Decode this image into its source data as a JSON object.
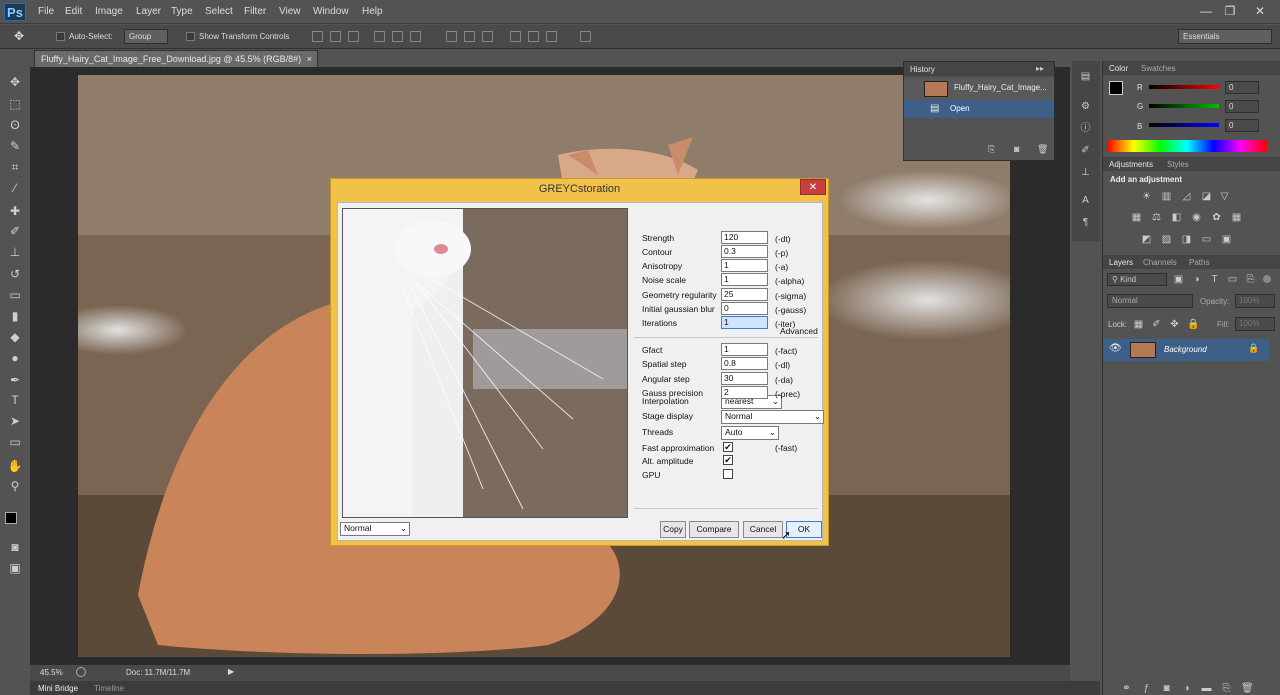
{
  "app": {
    "logo": "Ps"
  },
  "menu": [
    "File",
    "Edit",
    "Image",
    "Layer",
    "Type",
    "Select",
    "Filter",
    "View",
    "Window",
    "Help"
  ],
  "window_controls": {
    "minimize": "—",
    "restore": "❐",
    "close": "✕"
  },
  "options_bar": {
    "auto_select_label": "Auto-Select:",
    "auto_select_value": "Group",
    "transform_label": "Show Transform Controls",
    "workspace": "Essentials"
  },
  "document": {
    "tab_title": "Fluffy_Hairy_Cat_Image_Free_Download.jpg @ 45.5% (RGB/8#)",
    "zoom": "45.5%",
    "doc_size": "Doc: 11.7M/11.7M"
  },
  "bottom_tabs": [
    "Mini Bridge",
    "Timeline"
  ],
  "history": {
    "tab": "History",
    "items": [
      {
        "label": "Fluffy_Hairy_Cat_Image..."
      },
      {
        "label": "Open"
      }
    ]
  },
  "color_panel": {
    "tabs": [
      "Color",
      "Swatches"
    ],
    "channels": [
      {
        "label": "R",
        "value": "0",
        "color": "#ff0000"
      },
      {
        "label": "G",
        "value": "0",
        "color": "#00c000"
      },
      {
        "label": "B",
        "value": "0",
        "color": "#0000ff"
      }
    ]
  },
  "adjustments_panel": {
    "tabs": [
      "Adjustments",
      "Styles"
    ],
    "heading": "Add an adjustment"
  },
  "layers_panel": {
    "tabs": [
      "Layers",
      "Channels",
      "Paths"
    ],
    "kind_label": "Kind",
    "blend_mode": "Normal",
    "opacity_label": "Opacity:",
    "opacity_value": "100%",
    "lock_label": "Lock:",
    "fill_label": "Fill:",
    "fill_value": "100%",
    "layers": [
      {
        "name": "Background"
      }
    ]
  },
  "dialog": {
    "title": "GREYCstoration",
    "close": "✕",
    "params": [
      {
        "label": "Strength",
        "value": "120",
        "cli": "(-dt)"
      },
      {
        "label": "Contour",
        "value": "0.3",
        "cli": "(-p)"
      },
      {
        "label": "Anisotropy",
        "value": "1",
        "cli": "(-a)"
      },
      {
        "label": "Noise scale",
        "value": "1",
        "cli": "(-alpha)"
      },
      {
        "label": "Geometry regularity",
        "value": "25",
        "cli": "(-sigma)"
      },
      {
        "label": "Initial gaussian blur",
        "value": "0",
        "cli": "(-gauss)"
      },
      {
        "label": "Iterations",
        "value": "1",
        "cli": "(-iter)"
      }
    ],
    "advanced_label": "Advanced",
    "advanced_params": [
      {
        "label": "Gfact",
        "value": "1",
        "cli": "(-fact)"
      },
      {
        "label": "Spatial step",
        "value": "0.8",
        "cli": "(-dl)"
      },
      {
        "label": "Angular step",
        "value": "30",
        "cli": "(-da)"
      },
      {
        "label": "Gauss precision",
        "value": "2",
        "cli": "(-prec)"
      }
    ],
    "interpolation": {
      "label": "Interpolation",
      "value": "nearest"
    },
    "stage_display": {
      "label": "Stage display",
      "value": "Normal"
    },
    "threads": {
      "label": "Threads",
      "value": "Auto"
    },
    "checks": [
      {
        "label": "Fast approximation",
        "checked": true,
        "cli": "(-fast)"
      },
      {
        "label": "Alt. amplitude",
        "checked": true,
        "cli": ""
      },
      {
        "label": "GPU",
        "checked": false,
        "cli": ""
      }
    ],
    "preview_mode": "Normal",
    "buttons": {
      "copy": "Copy",
      "compare": "Compare",
      "cancel": "Cancel",
      "ok": "OK"
    }
  }
}
